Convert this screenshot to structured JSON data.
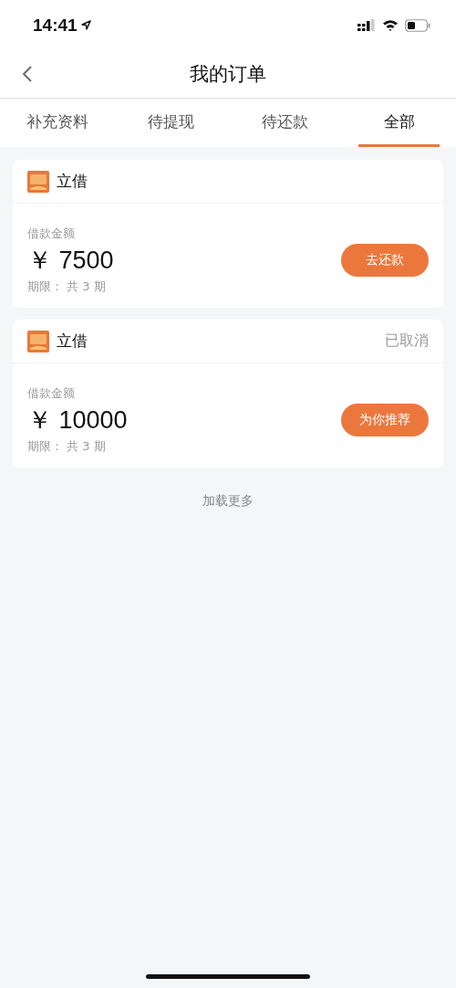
{
  "status_bar": {
    "time": "14:41"
  },
  "nav": {
    "title": "我的订单"
  },
  "tabs": [
    {
      "label": "补充资料",
      "selected": false
    },
    {
      "label": "待提现",
      "selected": false
    },
    {
      "label": "待还款",
      "selected": false
    },
    {
      "label": "全部",
      "selected": true
    }
  ],
  "orders": [
    {
      "brand": "立借",
      "amount_label": "借款金额",
      "amount": "￥ 7500",
      "term": "期限：  共 3 期",
      "action": "去还款"
    },
    {
      "brand": "立借",
      "status": "已取消",
      "amount_label": "借款金额",
      "amount": "￥ 10000",
      "term": "期限：  共 3 期",
      "action": "为你推荐"
    }
  ],
  "load_more": "加载更多"
}
